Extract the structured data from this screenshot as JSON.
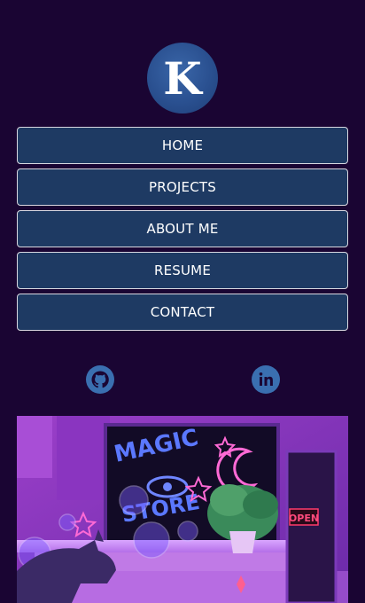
{
  "logo": {
    "letter": "K"
  },
  "nav": {
    "items": [
      {
        "id": "home",
        "label": "HOME"
      },
      {
        "id": "projects",
        "label": "PROJECTS"
      },
      {
        "id": "about",
        "label": "ABOUT ME"
      },
      {
        "id": "resume",
        "label": "RESUME"
      },
      {
        "id": "contact",
        "label": "CONTACT"
      }
    ]
  },
  "social": [
    {
      "icon": "github-icon"
    },
    {
      "icon": "linkedin-icon"
    }
  ],
  "hero": {
    "sign_text": "OPEN",
    "window_text": "MAGIC STORE"
  },
  "colors": {
    "background": "#1a0533",
    "button": "#1e3a63",
    "button_border": "#d8d8e0",
    "icon": "#3a6fb0"
  }
}
